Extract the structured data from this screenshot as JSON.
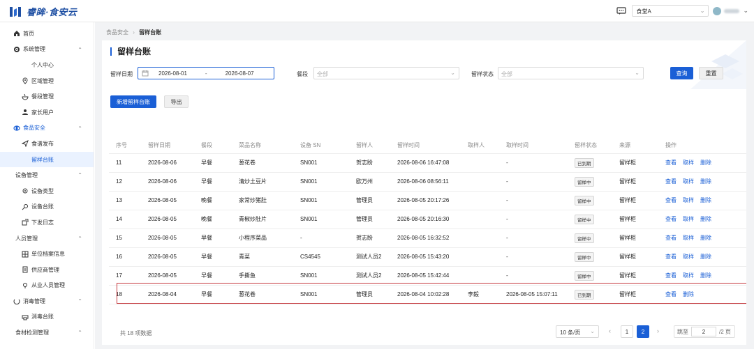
{
  "app": {
    "name": "睿眸·食安云",
    "store": "食堂A"
  },
  "sidebar": [
    {
      "label": "首页",
      "type": "lvl1",
      "icon": "home-icon"
    },
    {
      "label": "系统管理",
      "type": "lvl1",
      "icon": "gear-icon",
      "expanded": true
    },
    {
      "label": "个人中心",
      "type": "lvl2",
      "icon": ""
    },
    {
      "label": "区域管理",
      "type": "lvl2",
      "icon": "location-icon"
    },
    {
      "label": "餐段管理",
      "type": "lvl2",
      "icon": "bowl-icon"
    },
    {
      "label": "家长用户",
      "type": "lvl2",
      "icon": "user-icon"
    },
    {
      "label": "食品安全",
      "type": "lvl1",
      "icon": "shield-icon",
      "expanded": true,
      "open": true
    },
    {
      "label": "食谱发布",
      "type": "lvl2",
      "icon": "send-icon"
    },
    {
      "label": "留样台账",
      "type": "lvl2",
      "icon": "",
      "active": true
    },
    {
      "label": "设备管理",
      "type": "nolvl",
      "icon": "",
      "expanded": true
    },
    {
      "label": "设备类型",
      "type": "lvl2",
      "icon": "settings-icon"
    },
    {
      "label": "设备台账",
      "type": "lvl2",
      "icon": "key-icon"
    },
    {
      "label": "下发日志",
      "type": "lvl2",
      "icon": "export-icon"
    },
    {
      "label": "人员管理",
      "type": "nolvl",
      "icon": "",
      "expanded": true
    },
    {
      "label": "单位档案信息",
      "type": "lvl2",
      "icon": "grid-icon"
    },
    {
      "label": "供应商管理",
      "type": "lvl2",
      "icon": "doc-icon"
    },
    {
      "label": "从业人员管理",
      "type": "lvl2",
      "icon": "pin-icon"
    },
    {
      "label": "消毒管理",
      "type": "lvl1",
      "icon": "ring-icon",
      "expanded": true
    },
    {
      "label": "消毒台账",
      "type": "lvl2",
      "icon": "printer-icon"
    },
    {
      "label": "食材检测管理",
      "type": "nolvl",
      "icon": "",
      "expanded": true
    }
  ],
  "breadcrumb": {
    "parent": "食品安全",
    "current": "留样台账"
  },
  "page_title": "留样台账",
  "filters": {
    "date_label": "留样日期",
    "date_start": "2026-08-01",
    "date_sep": "-",
    "date_end": "2026-08-07",
    "meal_label": "餐段",
    "meal_placeholder": "全部",
    "status_label": "留样状态",
    "status_placeholder": "全部",
    "query_btn": "查询",
    "reset_btn": "重置"
  },
  "actions": {
    "add_btn": "新增留样台账",
    "export_btn": "导出"
  },
  "table": {
    "columns": [
      "序号",
      "留样日期",
      "餐段",
      "菜品名称",
      "设备 SN",
      "留样人",
      "留样时间",
      "取样人",
      "取样时间",
      "留样状态",
      "来源",
      "操作"
    ],
    "rows": [
      {
        "no": "11",
        "date": "2026-08-06",
        "meal": "早餐",
        "dish": "葱花卷",
        "sn": "SN001",
        "person": "贺志盼",
        "time": "2026-08-06 16:47:08",
        "taker": "",
        "take_time": "-",
        "status": "已到期",
        "source": "留样柜",
        "ops": [
          "查看",
          "取样",
          "删除"
        ]
      },
      {
        "no": "12",
        "date": "2026-08-06",
        "meal": "早餐",
        "dish": "清炒土豆片",
        "sn": "SN001",
        "person": "欧万州",
        "time": "2026-08-06 08:56:11",
        "taker": "",
        "take_time": "-",
        "status": "留样中",
        "source": "留样柜",
        "ops": [
          "查看",
          "取样",
          "删除"
        ]
      },
      {
        "no": "13",
        "date": "2026-08-05",
        "meal": "晚餐",
        "dish": "家常炒猪肚",
        "sn": "SN001",
        "person": "管理员",
        "time": "2026-08-05 20:17:26",
        "taker": "",
        "take_time": "-",
        "status": "留样中",
        "source": "留样柜",
        "ops": [
          "查看",
          "取样",
          "删除"
        ]
      },
      {
        "no": "14",
        "date": "2026-08-05",
        "meal": "晚餐",
        "dish": "青椒炒肚片",
        "sn": "SN001",
        "person": "管理员",
        "time": "2026-08-05 20:16:30",
        "taker": "",
        "take_time": "-",
        "status": "留样中",
        "source": "留样柜",
        "ops": [
          "查看",
          "取样",
          "删除"
        ]
      },
      {
        "no": "15",
        "date": "2026-08-05",
        "meal": "早餐",
        "dish": "小程序菜品",
        "sn": "-",
        "person": "贺志盼",
        "time": "2026-08-05 16:32:52",
        "taker": "",
        "take_time": "-",
        "status": "留样中",
        "source": "留样柜",
        "ops": [
          "查看",
          "取样",
          "删除"
        ]
      },
      {
        "no": "16",
        "date": "2026-08-05",
        "meal": "早餐",
        "dish": "青菜",
        "sn": "CS4545",
        "person": "测试人员2",
        "time": "2026-08-05 15:43:20",
        "taker": "",
        "take_time": "-",
        "status": "留样中",
        "source": "留样柜",
        "ops": [
          "查看",
          "取样",
          "删除"
        ]
      },
      {
        "no": "17",
        "date": "2026-08-05",
        "meal": "早餐",
        "dish": "手撕鱼",
        "sn": "SN001",
        "person": "测试人员2",
        "time": "2026-08-05 15:42:44",
        "taker": "",
        "take_time": "-",
        "status": "留样中",
        "source": "留样柜",
        "ops": [
          "查看",
          "取样",
          "删除"
        ]
      },
      {
        "no": "18",
        "date": "2026-08-04",
        "meal": "早餐",
        "dish": "葱花卷",
        "sn": "SN001",
        "person": "管理员",
        "time": "2026-08-04 10:02:28",
        "taker": "李毅",
        "take_time": "2026-08-05 15:07:11",
        "status": "已到期",
        "source": "留样柜",
        "ops": [
          "查看",
          "删除"
        ]
      }
    ]
  },
  "pagination": {
    "total_text": "共 18 项数据",
    "page_size": "10 条/页",
    "prev": "‹",
    "pages": [
      "1",
      "2"
    ],
    "current": "2",
    "next": "›",
    "jump_label": "跳至",
    "jump_value": "2",
    "total_pages": "/2 页"
  },
  "colors": {
    "primary": "#1a5fd6",
    "highlight": "#c63a3f"
  }
}
